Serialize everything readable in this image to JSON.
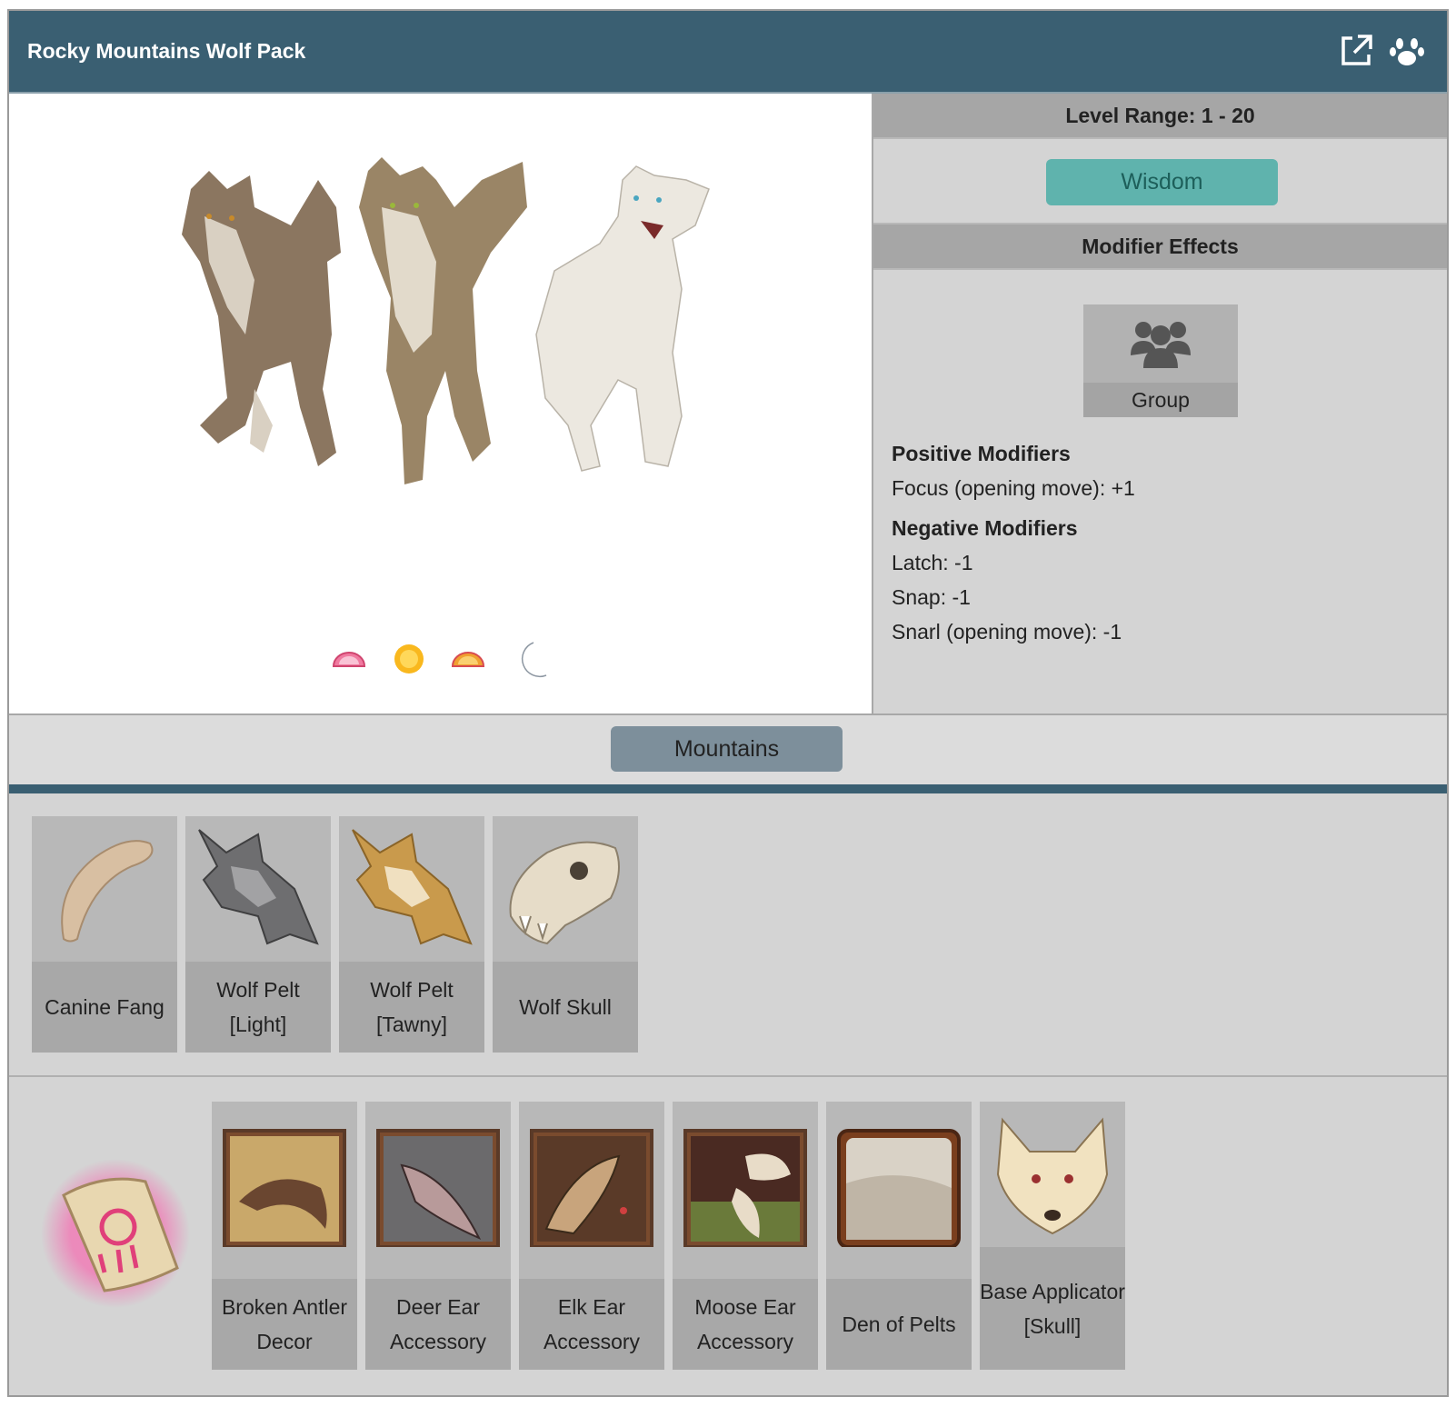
{
  "header": {
    "title": "Rocky Mountains Wolf Pack",
    "icons": [
      "external-link-icon",
      "paw-icon"
    ]
  },
  "scene": {
    "art": "three-wolves",
    "time_icons": [
      "dawn-icon",
      "sun-icon",
      "dusk-icon",
      "moon-icon"
    ]
  },
  "side": {
    "level_range": "Level Range: 1 - 20",
    "stat_button": "Wisdom",
    "modifier_title": "Modifier Effects",
    "group_label": "Group",
    "positive_heading": "Positive Modifiers",
    "positive": [
      "Focus (opening move): +1"
    ],
    "negative_heading": "Negative Modifiers",
    "negative": [
      "Latch: -1",
      "Snap: -1",
      "Snarl (opening move): -1"
    ]
  },
  "biome": {
    "label": "Mountains"
  },
  "drops": [
    {
      "name": "Canine Fang",
      "icon": "canine-fang-icon"
    },
    {
      "name": "Wolf Pelt [Light]",
      "icon": "wolf-pelt-light-icon"
    },
    {
      "name": "Wolf Pelt [Tawny]",
      "icon": "wolf-pelt-tawny-icon"
    },
    {
      "name": "Wolf Skull",
      "icon": "wolf-skull-icon"
    }
  ],
  "rewards": [
    {
      "name": "Broken Antler Decor",
      "icon": "broken-antler-icon"
    },
    {
      "name": "Deer Ear Accessory",
      "icon": "deer-ear-icon"
    },
    {
      "name": "Elk Ear Accessory",
      "icon": "elk-ear-icon"
    },
    {
      "name": "Moose Ear Accessory",
      "icon": "moose-ear-icon"
    },
    {
      "name": "Den of Pelts",
      "icon": "den-of-pelts-icon"
    },
    {
      "name": "Base Applicator [Skull]",
      "icon": "base-applicator-skull-icon"
    }
  ],
  "colors": {
    "header": "#3a5f72",
    "wisdom": "#5fb3ad",
    "biome": "#7d8f9b",
    "panel": "#d4d4d4"
  }
}
